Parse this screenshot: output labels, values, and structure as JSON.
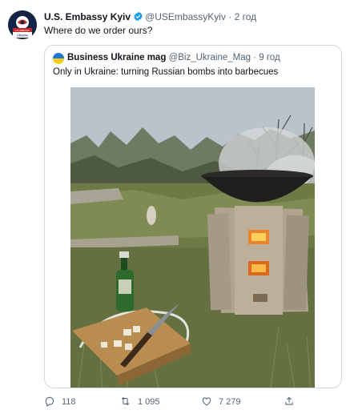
{
  "tweet": {
    "author_name": "U.S. Embassy Kyiv",
    "author_handle": "@USEmbassyKyiv",
    "separator": "·",
    "time": "2 год",
    "text": "Where do we order ours?",
    "avatar_label": "Ukraine",
    "avatar_banner": "U.S. EMBASSY"
  },
  "quote": {
    "author_name": "Business Ukraine mag",
    "author_handle": "@Biz_Ukraine_Mag",
    "separator": "·",
    "time": "9 год",
    "text": "Only in Ukraine: turning Russian bombs into barbecues"
  },
  "actions": {
    "reply_count": "118",
    "retweet_count": "1 095",
    "like_count": "7 279"
  },
  "colors": {
    "verified": "#1d9bf0",
    "secondary_text": "#536471",
    "border": "#cfd9de"
  },
  "icons": [
    "verified-badge-icon",
    "reply-icon",
    "retweet-icon",
    "like-icon",
    "share-icon"
  ]
}
